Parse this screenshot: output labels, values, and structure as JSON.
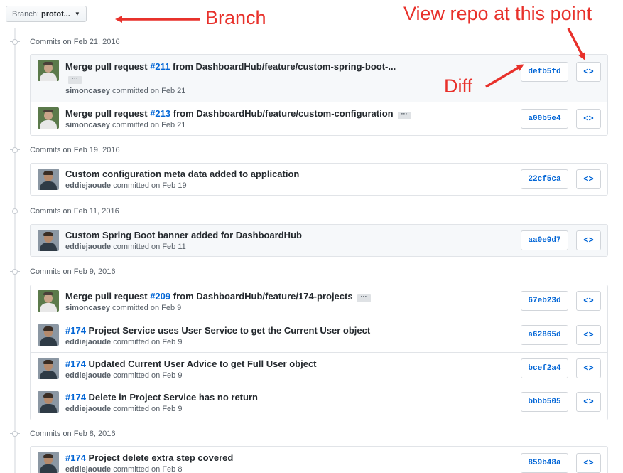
{
  "branch": {
    "prefix": "Branch:",
    "name": "protot...",
    "caret": "▼"
  },
  "groups": [
    {
      "header": "Commits on Feb 21, 2016",
      "commits": [
        {
          "title_pre": "Merge pull request ",
          "pr": "#211",
          "title_post": " from DashboardHub/feature/custom-spring-boot-...",
          "author": "simoncasey",
          "meta": " committed on Feb 21",
          "sha": "defb5fd",
          "ellipsis": "···"
        },
        {
          "title_pre": "Merge pull request ",
          "pr": "#213",
          "title_post": " from DashboardHub/feature/custom-configuration",
          "author": "simoncasey",
          "meta": " committed on Feb 21",
          "sha": "a00b5e4",
          "ellipsis": "···"
        }
      ]
    },
    {
      "header": "Commits on Feb 19, 2016",
      "commits": [
        {
          "title": "Custom configuration meta data added to application",
          "author": "eddiejaoude",
          "meta": " committed on Feb 19",
          "sha": "22cf5ca"
        }
      ]
    },
    {
      "header": "Commits on Feb 11, 2016",
      "commits": [
        {
          "title": "Custom Spring Boot banner added for DashboardHub",
          "author": "eddiejaoude",
          "meta": " committed on Feb 11",
          "sha": "aa0e9d7"
        }
      ]
    },
    {
      "header": "Commits on Feb 9, 2016",
      "commits": [
        {
          "title_pre": "Merge pull request ",
          "pr": "#209",
          "title_post": " from DashboardHub/feature/174-projects",
          "author": "simoncasey",
          "meta": " committed on Feb 9",
          "sha": "67eb23d",
          "ellipsis": "···"
        },
        {
          "pr": "#174",
          "title_post": " Project Service uses User Service to get the Current User object",
          "author": "eddiejaoude",
          "meta": " committed on Feb 9",
          "sha": "a62865d"
        },
        {
          "pr": "#174",
          "title_post": " Updated Current User Advice to get Full User object",
          "author": "eddiejaoude",
          "meta": " committed on Feb 9",
          "sha": "bcef2a4"
        },
        {
          "pr": "#174",
          "title_post": " Delete in Project Service has no return",
          "author": "eddiejaoude",
          "meta": " committed on Feb 9",
          "sha": "bbbb505"
        }
      ]
    },
    {
      "header": "Commits on Feb 8, 2016",
      "commits": [
        {
          "pr": "#174",
          "title_post": " Project delete extra step covered",
          "author": "eddiejaoude",
          "meta": " committed on Feb 8",
          "sha": "859b48a"
        }
      ]
    }
  ],
  "browse_glyph": "<>",
  "annotations": {
    "branch": "Branch",
    "view_repo": "View repo at this point",
    "diff": "Diff",
    "color": "#e8312b"
  }
}
